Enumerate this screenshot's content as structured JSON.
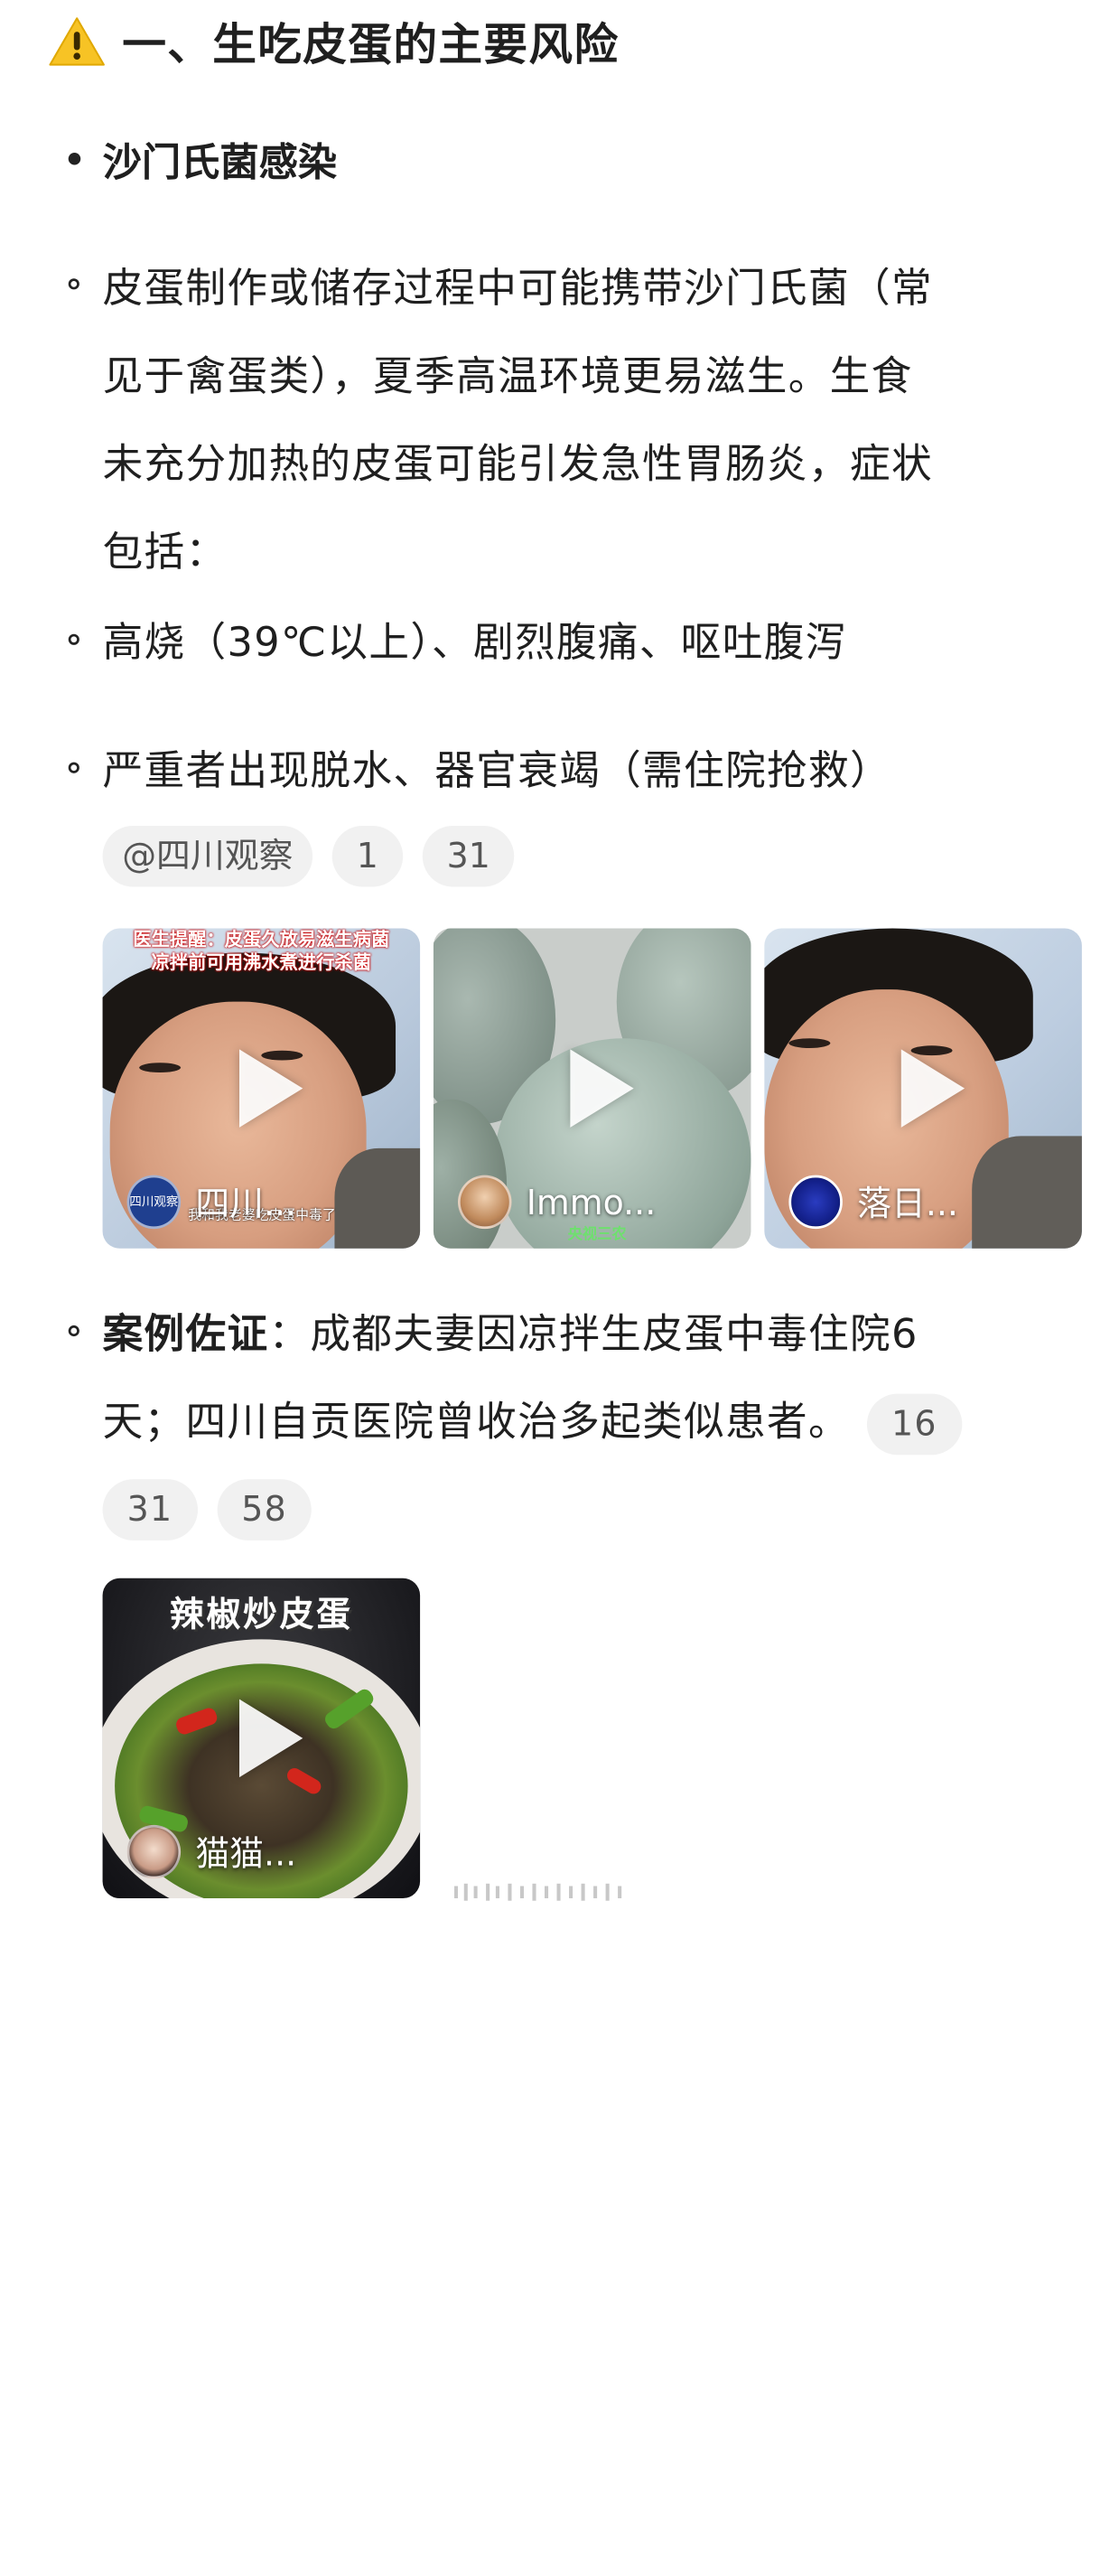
{
  "heading": {
    "icon": "warning-icon",
    "text": "一、生吃皮蛋的主要风险"
  },
  "section": {
    "title": "沙门氏菌感染",
    "intro": [
      "皮蛋制作或储存过程中可能携带沙门氏菌（常",
      "见于禽蛋类），夏季高温环境更易滋生。生食",
      "未充分加热的皮蛋可能引发急性胃肠炎，症状",
      "包括："
    ],
    "symptom1": "高烧（39℃以上）、剧烈腹痛、呕吐腹泻",
    "symptom2": "严重者出现脱水、器官衰竭（需住院抢救）"
  },
  "chips_1": {
    "source": "@四川观察",
    "ref1": "1",
    "ref2": "31"
  },
  "videos": [
    {
      "author": "四川...",
      "banner_line1": "医生提醒：皮蛋久放易滋生病菌",
      "banner_line2": "凉拌前可用沸水煮进行杀菌",
      "logo": "四川观察",
      "caption": "我和我老婆吃皮蛋中毒了"
    },
    {
      "author": "Immo...",
      "watermark": "央视三农"
    },
    {
      "author": "落日..."
    }
  ],
  "case": {
    "label": "案例佐证",
    "colon": "：",
    "line1": "成都夫妻因凉拌生皮蛋中毒住院6",
    "line2": "天；四川自贡医院曾收治多起类似患者。",
    "ref1": "16",
    "ref2": "31",
    "ref3": "58"
  },
  "video_bottom": {
    "title": "辣椒炒皮蛋",
    "author": "猫猫..."
  }
}
